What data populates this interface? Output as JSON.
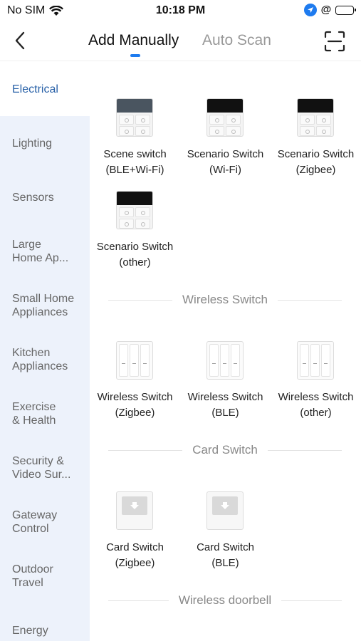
{
  "status_bar": {
    "carrier": "No SIM",
    "time": "10:18 PM",
    "battery_level": 0.45
  },
  "nav": {
    "tabs": [
      "Add Manually",
      "Auto Scan"
    ],
    "active_tab": 0
  },
  "sidebar": {
    "items": [
      {
        "label": "Electrical"
      },
      {
        "label": "Lighting"
      },
      {
        "label": "Sensors"
      },
      {
        "label": "Large\nHome Ap..."
      },
      {
        "label": "Small Home\nAppliances"
      },
      {
        "label": "Kitchen\nAppliances"
      },
      {
        "label": "Exercise\n& Health"
      },
      {
        "label": "Security &\nVideo Sur..."
      },
      {
        "label": "Gateway\nControl"
      },
      {
        "label": "Outdoor\nTravel"
      },
      {
        "label": "Energy"
      }
    ],
    "active_index": 0
  },
  "content": {
    "groups": [
      {
        "title": "",
        "devices": [
          {
            "line1": "Scene switch",
            "line2": "(BLE+Wi-Fi)",
            "icon": "scene-switch-icon"
          },
          {
            "line1": "Scenario Switch",
            "line2": "(Wi-Fi)",
            "icon": "scenario-switch-icon"
          },
          {
            "line1": "Scenario Switch",
            "line2": "(Zigbee)",
            "icon": "scenario-switch-icon"
          },
          {
            "line1": "Scenario Switch",
            "line2": "(other)",
            "icon": "scenario-switch-icon"
          }
        ]
      },
      {
        "title": "Wireless Switch",
        "devices": [
          {
            "line1": "Wireless Switch",
            "line2": "(Zigbee)",
            "icon": "wireless-switch-icon"
          },
          {
            "line1": "Wireless Switch",
            "line2": "(BLE)",
            "icon": "wireless-switch-icon"
          },
          {
            "line1": "Wireless Switch",
            "line2": "(other)",
            "icon": "wireless-switch-icon"
          }
        ]
      },
      {
        "title": "Card Switch",
        "devices": [
          {
            "line1": "Card Switch",
            "line2": "(Zigbee)",
            "icon": "card-switch-icon"
          },
          {
            "line1": "Card Switch",
            "line2": "(BLE)",
            "icon": "card-switch-icon"
          }
        ]
      },
      {
        "title": "Wireless doorbell",
        "devices": []
      }
    ]
  },
  "colors": {
    "accent": "#1e7bef",
    "sidebar_active_text": "#2a62a8",
    "sidebar_bg": "#edf2fb"
  }
}
